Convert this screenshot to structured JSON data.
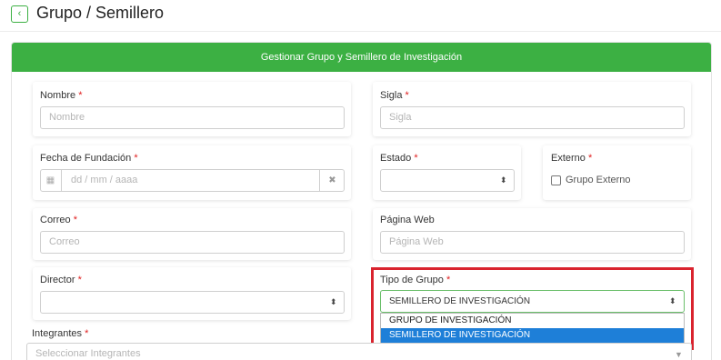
{
  "header": {
    "back_icon": "chevron-left-icon",
    "back_symbol": "‹",
    "title": "Grupo / Semillero"
  },
  "panel": {
    "title": "Gestionar Grupo y Semillero de Investigación",
    "accent_color": "#3cb043"
  },
  "required_mark": "*",
  "form": {
    "nombre": {
      "label": "Nombre",
      "placeholder": "Nombre"
    },
    "sigla": {
      "label": "Sigla",
      "placeholder": "Sigla"
    },
    "fecha": {
      "label": "Fecha de Fundación",
      "placeholder": "dd / mm / aaaa",
      "calendar_icon": "calendar-icon",
      "calendar_symbol": "▦",
      "clear_icon": "clear-icon",
      "clear_symbol": "✖"
    },
    "estado": {
      "label": "Estado",
      "value": "",
      "caret": "⬍"
    },
    "externo": {
      "label": "Externo",
      "checkbox_label": "Grupo Externo",
      "checked": false
    },
    "correo": {
      "label": "Correo",
      "placeholder": "Correo"
    },
    "pagina_web": {
      "label": "Página Web",
      "placeholder": "Página Web"
    },
    "director": {
      "label": "Director",
      "value": "",
      "caret": "⬍"
    },
    "tipo_grupo": {
      "label": "Tipo de Grupo",
      "value": "SEMILLERO DE INVESTIGACIÓN",
      "caret": "⬍",
      "options": [
        "GRUPO DE INVESTIGACIÓN",
        "SEMILLERO DE INVESTIGACIÓN"
      ],
      "selected_index": 1,
      "highlight_color": "#d9232e"
    },
    "integrantes": {
      "label": "Integrantes",
      "placeholder": "Seleccionar Integrantes",
      "caret": "▼"
    }
  }
}
